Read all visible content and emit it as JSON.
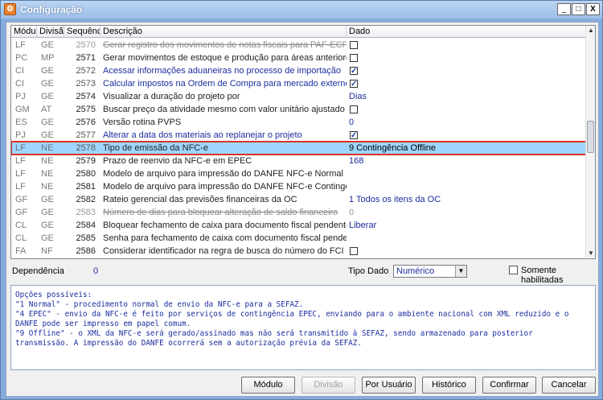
{
  "window": {
    "title": "Configuração",
    "minimize": "_",
    "maximize": "□",
    "close": "X"
  },
  "grid": {
    "headers": {
      "modulo": "Módulo",
      "divisao": "Divisão",
      "sequencia": "Sequência",
      "descricao": "Descrição",
      "dado": "Dado"
    },
    "rows": [
      {
        "mod": "LF",
        "div": "GE",
        "seq": "2570",
        "desc": "Gerar registro dos movimentos de notas fiscais para PAF-ECF",
        "dado": "",
        "check": false,
        "state": "disabled"
      },
      {
        "mod": "PC",
        "div": "MP",
        "seq": "2571",
        "desc": "Gerar movimentos de estoque e produção para áreas anteriores",
        "dado": "",
        "check": false,
        "state": "bold"
      },
      {
        "mod": "CI",
        "div": "GE",
        "seq": "2572",
        "desc": "Acessar informações aduaneiras no processo de importação",
        "dado": "",
        "check": true,
        "state": "link"
      },
      {
        "mod": "CI",
        "div": "GE",
        "seq": "2573",
        "desc": "Calcular impostos na Ordem de Compra para mercado externo",
        "dado": "",
        "check": true,
        "state": "link"
      },
      {
        "mod": "PJ",
        "div": "GE",
        "seq": "2574",
        "desc": "Visualizar a duração do projeto por",
        "dado": "Dias",
        "check": null,
        "state": "bold"
      },
      {
        "mod": "GM",
        "div": "AT",
        "seq": "2575",
        "desc": "Buscar preço da atividade mesmo com valor unitário ajustado",
        "dado": "",
        "check": false,
        "state": "bold"
      },
      {
        "mod": "ES",
        "div": "GE",
        "seq": "2576",
        "desc": "Versão rotina PVPS",
        "dado": "0",
        "check": null,
        "state": "bold"
      },
      {
        "mod": "PJ",
        "div": "GE",
        "seq": "2577",
        "desc": "Alterar a data dos materiais ao replanejar o projeto",
        "dado": "",
        "check": true,
        "state": "link"
      },
      {
        "mod": "LF",
        "div": "NE",
        "seq": "2578",
        "desc": "Tipo de emissão da NFC-e",
        "dado": "9 Contingência Offline",
        "check": null,
        "state": "selected"
      },
      {
        "mod": "LF",
        "div": "NE",
        "seq": "2579",
        "desc": "Prazo de reenvio da NFC-e em EPEC",
        "dado": "168",
        "check": null,
        "state": "bold"
      },
      {
        "mod": "LF",
        "div": "NE",
        "seq": "2580",
        "desc": "Modelo de arquivo para impressão do DANFE NFC-e Normal",
        "dado": "",
        "check": null,
        "state": "bold"
      },
      {
        "mod": "LF",
        "div": "NE",
        "seq": "2581",
        "desc": "Modelo de arquivo para impressão do DANFE NFC-e Contingência",
        "dado": "",
        "check": null,
        "state": "bold"
      },
      {
        "mod": "GF",
        "div": "GE",
        "seq": "2582",
        "desc": "Rateio gerencial das previsões financeiras da OC",
        "dado": "1 Todos os itens da OC",
        "check": null,
        "state": "bold"
      },
      {
        "mod": "GF",
        "div": "GE",
        "seq": "2583",
        "desc": "Número de dias para bloquear alteração de saldo financeiro",
        "dado": "0",
        "check": null,
        "state": "disabled"
      },
      {
        "mod": "CL",
        "div": "GE",
        "seq": "2584",
        "desc": "Bloquear fechamento de caixa para documento fiscal pendente",
        "dado": "Liberar",
        "check": null,
        "state": "bold"
      },
      {
        "mod": "CL",
        "div": "GE",
        "seq": "2585",
        "desc": "Senha para fechamento de caixa com documento fiscal pendente",
        "dado": "",
        "check": null,
        "state": "bold"
      },
      {
        "mod": "FA",
        "div": "NF",
        "seq": "2586",
        "desc": "Considerar identificador na regra de busca do número do FCI",
        "dado": "",
        "check": false,
        "state": "bold"
      }
    ]
  },
  "filters": {
    "dependencia_label": "Dependência",
    "dependencia_value": "0",
    "tipo_dado_label": "Tipo Dado",
    "tipo_dado_value": "Numérico",
    "somente_label": "Somente habilitadas"
  },
  "info": {
    "lines": [
      "Opções possíveis:",
      "\"1 Normal\" - procedimento normal de envio da NFC-e para a SEFAZ.",
      "\"4 EPEC\" - envio da NFC-e é feito por serviços de contingência EPEC, enviando para o ambiente nacional com XML reduzido e o",
      "DANFE pode ser impresso em papel comum.",
      "\"9 Offline\" - o XML da NFC-e será gerado/assinado mas não será transmitido à SEFAZ, sendo armazenado para posterior",
      "transmissão. A impressão do DANFE ocorrerá sem a autorização prévia da SEFAZ."
    ]
  },
  "buttons": {
    "modulo": "Módulo",
    "divisao": "Divisão",
    "por_usuario": "Por Usuário",
    "historico": "Histórico",
    "confirmar": "Confirmar",
    "cancelar": "Cancelar"
  }
}
